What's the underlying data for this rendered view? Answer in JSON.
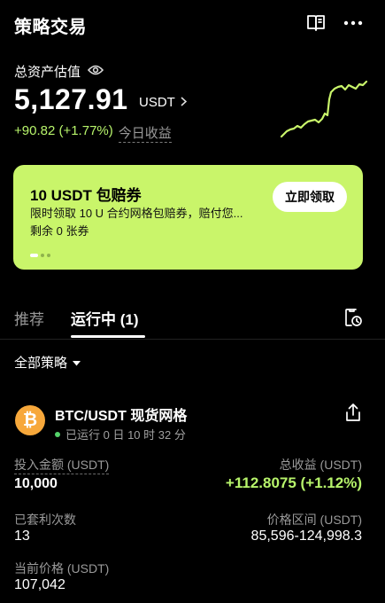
{
  "header": {
    "title": "策略交易"
  },
  "assets": {
    "label": "总资产估值",
    "value": "5,127.91",
    "unit": "USDT",
    "pnl": "+90.82 (+1.77%)",
    "pnl_label": "今日收益"
  },
  "colors": {
    "accent": "#c9f56a",
    "positive": "#b7f46b",
    "coin": "#f7a83b"
  },
  "promo": {
    "title": "10 USDT 包赔券",
    "description": "限时领取 10 U 合约网格包赔券，赔付您...",
    "remaining": "剩余 0 张券",
    "button": "立即领取"
  },
  "tabs": {
    "recommended": "推荐",
    "running": "运行中 (1)"
  },
  "filter": {
    "label": "全部策略"
  },
  "strategy": {
    "coin_symbol": "₿",
    "pair": "BTC/USDT 现货网格",
    "status": "已运行 0 日 10 时 32 分",
    "invest_label": "投入金额 (USDT)",
    "invest_value": "10,000",
    "profit_label": "总收益 (USDT)",
    "profit_value": "+112.8075 (+1.12%)",
    "arb_label": "已套利次数",
    "arb_value": "13",
    "range_label": "价格区间 (USDT)",
    "range_value": "85,596-124,998.3",
    "price_label": "当前价格 (USDT)",
    "price_value": "107,042"
  }
}
